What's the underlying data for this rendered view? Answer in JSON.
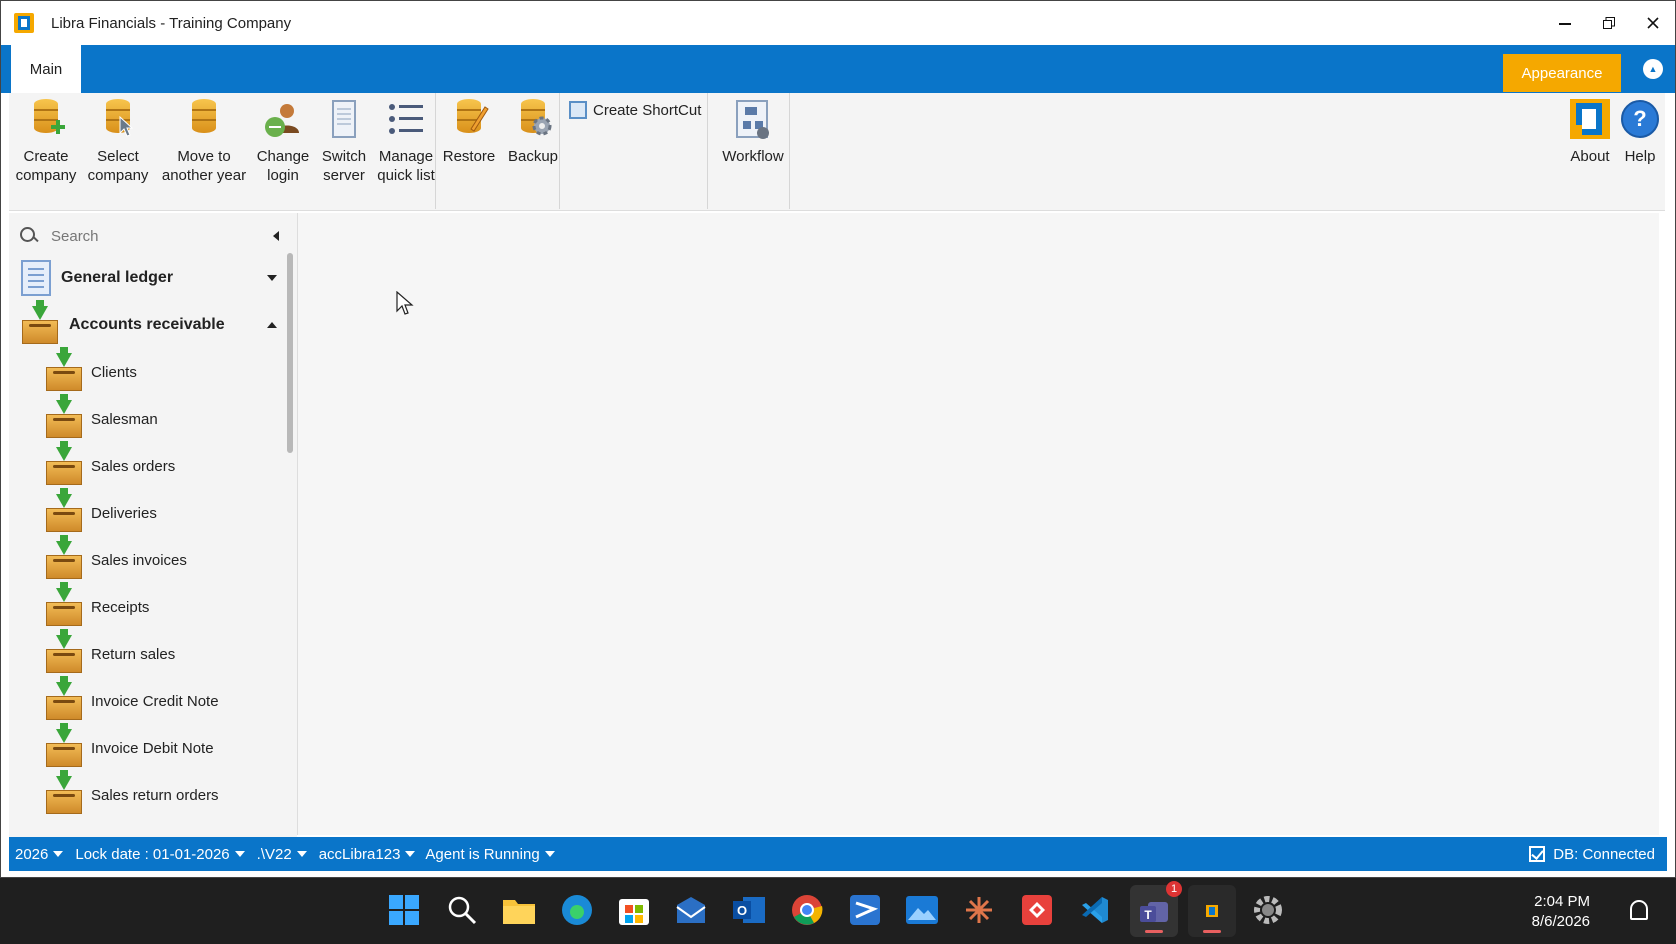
{
  "window": {
    "title": "Libra Financials - Training Company",
    "controls": [
      "minimize",
      "restore",
      "close"
    ]
  },
  "ribbon_tabs": {
    "main": "Main",
    "appearance": "Appearance"
  },
  "ribbon": {
    "create_company": "Create\ncompany",
    "select_company": "Select\ncompany",
    "move_year": "Move to\nanother year",
    "change_login": "Change\nlogin",
    "switch_server": "Switch\nserver",
    "manage_quick_list": "Manage\nquick list",
    "restore": "Restore",
    "backup": "Backup",
    "create_shortcut": "Create ShortCut",
    "workflow": "Workflow",
    "about": "About",
    "help": "Help"
  },
  "sidebar": {
    "search_placeholder": "Search",
    "groups": [
      {
        "label": "General ledger",
        "expanded": false
      },
      {
        "label": "Accounts receivable",
        "expanded": true
      }
    ],
    "items": [
      "Clients",
      "Salesman",
      "Sales orders",
      "Deliveries",
      "Sales invoices",
      "Receipts",
      "Return sales",
      "Invoice Credit Note",
      "Invoice Debit Note",
      "Sales return orders"
    ]
  },
  "statusbar": {
    "year": "2026",
    "lock_date": "Lock date : 01-01-2026",
    "server": ".\\V22",
    "user": "accLibra123",
    "agent": "Agent is Running",
    "db": "DB: Connected"
  },
  "taskbar": {
    "time": "2:04 PM",
    "date": "8/6/2026",
    "teams_badge": "1"
  },
  "colors": {
    "accent_blue": "#0a75c9",
    "appearance_orange": "#f5a800"
  }
}
